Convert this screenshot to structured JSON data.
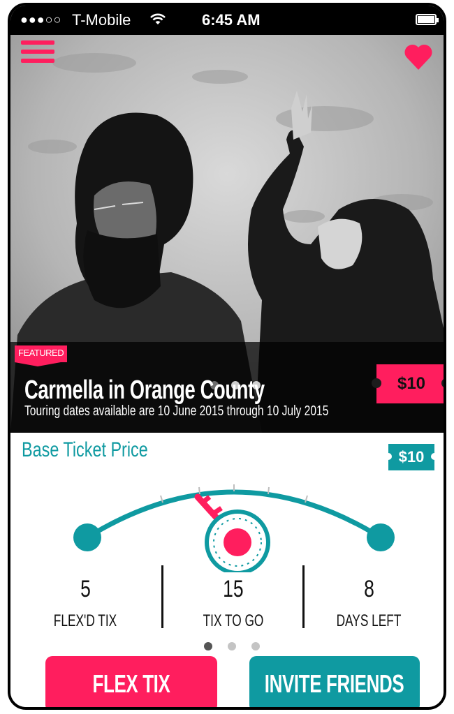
{
  "status_bar": {
    "signal": "●●●○○",
    "carrier": "T-Mobile",
    "wifi_icon": "wifi-icon",
    "time": "6:45 AM",
    "battery_icon": "battery-icon"
  },
  "header": {
    "menu_icon": "hamburger-menu-icon",
    "favorite_icon": "heart-icon"
  },
  "featured_event": {
    "badge": "FEATURED",
    "title": "Carmella in Orange County",
    "subtitle": "Touring dates available are 10 June 2015 through 10 July 2015",
    "price": "$10",
    "carousel": {
      "total": 3,
      "active_index": 0
    }
  },
  "ticket_panel": {
    "base_label": "Base Ticket Price",
    "base_price": "$10",
    "gauge": {
      "needle_icon": "key-icon"
    },
    "stats": [
      {
        "value": "5",
        "label": "FLEX'D TIX"
      },
      {
        "value": "15",
        "label": "TIX TO GO"
      },
      {
        "value": "8",
        "label": "DAYS LEFT"
      }
    ],
    "carousel": {
      "total": 3,
      "active_index": 0
    }
  },
  "actions": {
    "flex_label": "FLEX TIX",
    "invite_label": "INVITE FRIENDS"
  },
  "colors": {
    "accent_pink": "#ff1e5e",
    "accent_teal": "#0f9aa1",
    "status_bar_bg": "#000000"
  }
}
